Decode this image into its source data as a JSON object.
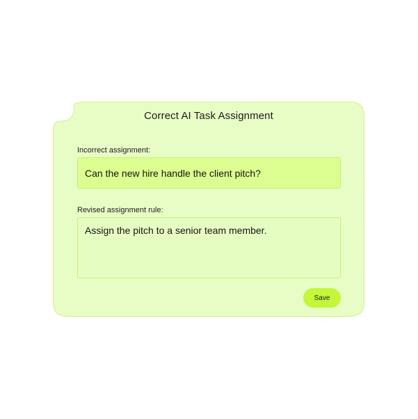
{
  "dialog": {
    "title": "Correct AI Task Assignment",
    "incorrect_label": "Incorrect assignment:",
    "incorrect_value": "Can the new hire handle the client pitch?",
    "revised_label": "Revised assignment rule:",
    "revised_value": "Assign the pitch to a senior team member.",
    "save_label": "Save"
  },
  "colors": {
    "card_background": "#e8fdc6",
    "card_border": "#d0f08c",
    "incorrect_field": "#dcfe90",
    "revised_field": "#e6fdc2",
    "save_button": "#c4f63a"
  }
}
